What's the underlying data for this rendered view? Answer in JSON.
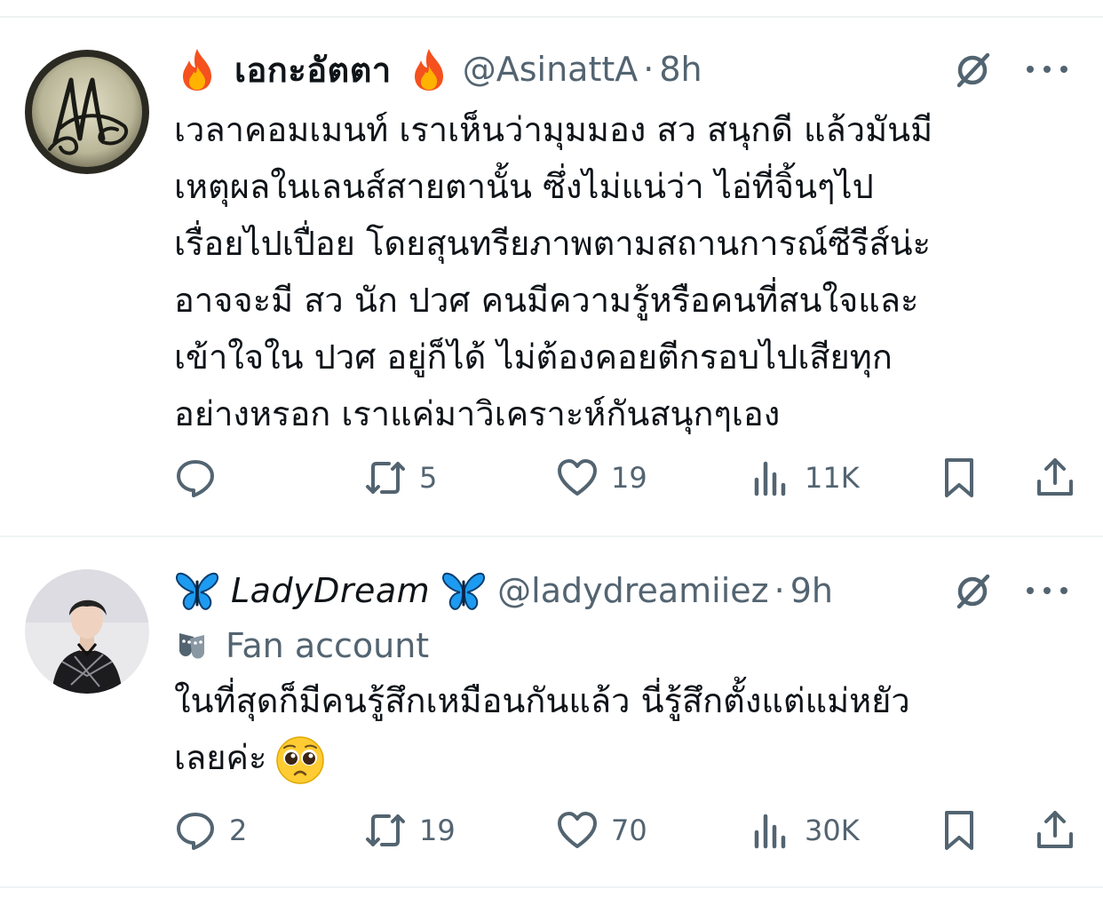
{
  "tweets": [
    {
      "display_name": "เอกะอัตตา",
      "handle": "@AsinattA",
      "separator": "·",
      "time": "8h",
      "text_lines": [
        "เวลาคอมเมนท์ เราเห็นว่ามุมมอง สว สนุกดี แล้วมันมี",
        "เหตุผลในเลนส์สายตานั้น ซึ่งไม่แน่ว่า ไอ่ที่จิ้นๆไป",
        "เรื่อยไปเปื่อย โดยสุนทรียภาพตามสถานการณ์ซีรีส์น่ะ",
        "อาจจะมี สว นัก ปวศ คนมีความรู้หรือคนที่สนใจและ",
        "เข้าใจใน ปวศ อยู่ก็ได้ ไม่ต้องคอยตีกรอบไปเสียทุก",
        "อย่างหรอก เราแค่มาวิเคราะห์กันสนุกๆเอง"
      ],
      "name_emoji": "fire-emoji",
      "replies": "",
      "reposts": "5",
      "likes": "19",
      "views": "11K"
    },
    {
      "display_name": "LadyDream",
      "handle": "@ladydreamiiez",
      "separator": "·",
      "time": "9h",
      "label": "Fan account",
      "text_lines": [
        "ในที่สุดก็มีคนรู้สึกเหมือนกันแล้ว นี่รู้สึกตั้งแต่แม่หยัว",
        "เลยค่ะ"
      ],
      "name_emoji": "butterfly-emoji",
      "text_emoji": "pleading-face-emoji",
      "replies": "2",
      "reposts": "19",
      "likes": "70",
      "views": "30K"
    }
  ],
  "colors": {
    "text": "#0f1419",
    "secondary": "#536471",
    "divider": "#eff3f4",
    "fire": "#f4511e",
    "butterfly": "#1d9bf0"
  }
}
